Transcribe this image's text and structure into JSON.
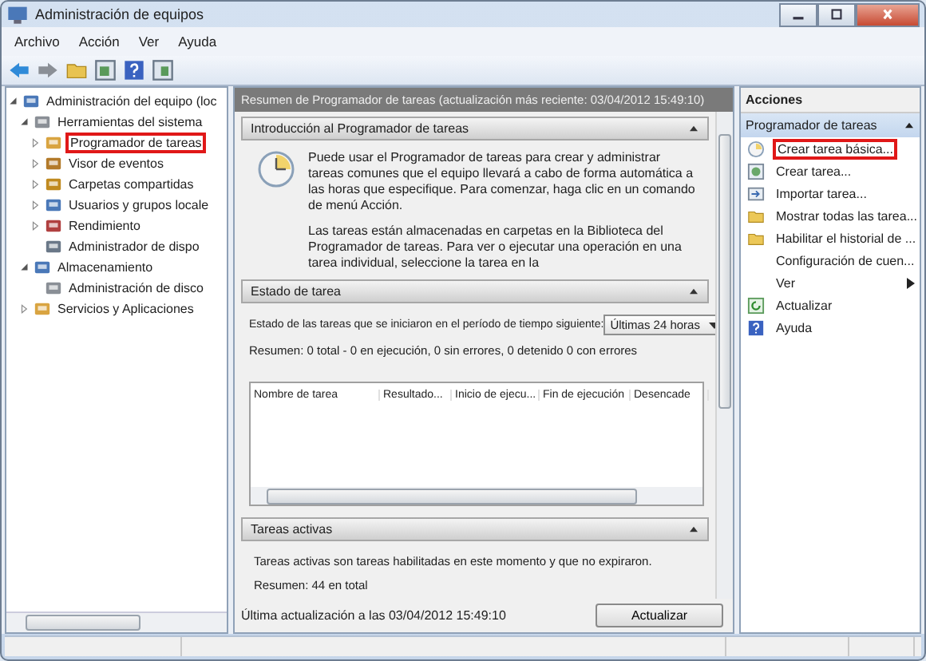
{
  "window": {
    "title": "Administración de equipos"
  },
  "menu": [
    "Archivo",
    "Acción",
    "Ver",
    "Ayuda"
  ],
  "tree": [
    {
      "label": "Administración del equipo (loc",
      "expanded": true,
      "highlighted": false,
      "children": [
        {
          "label": "Herramientas del sistema",
          "expanded": true,
          "highlighted": false,
          "children": [
            {
              "label": "Programador de tareas",
              "expanded": false,
              "highlighted": true
            },
            {
              "label": "Visor de eventos",
              "expanded": false,
              "highlighted": false
            },
            {
              "label": "Carpetas compartidas",
              "expanded": false,
              "highlighted": false
            },
            {
              "label": "Usuarios y grupos locale",
              "expanded": false,
              "highlighted": false
            },
            {
              "label": "Rendimiento",
              "expanded": false,
              "highlighted": false
            },
            {
              "label": "Administrador de dispo",
              "highlighted": false
            }
          ]
        },
        {
          "label": "Almacenamiento",
          "expanded": true,
          "highlighted": false,
          "children": [
            {
              "label": "Administración de disco",
              "highlighted": false
            }
          ]
        },
        {
          "label": "Servicios y Aplicaciones",
          "expanded": false,
          "highlighted": false
        }
      ]
    }
  ],
  "summary_header": "Resumen de Programador de tareas (actualización más reciente: 03/04/2012 15:49:10)",
  "intro": {
    "title": "Introducción al Programador de tareas",
    "expanded": true,
    "paragraphs": [
      "Puede usar el Programador de tareas para crear y administrar tareas comunes que el equipo llevará a cabo de forma automática a las horas que especifique. Para comenzar, haga clic en un comando de menú Acción.",
      "Las tareas están almacenadas en carpetas en la Biblioteca del Programador de tareas. Para ver o ejecutar una operación en una tarea individual, seleccione la tarea en la"
    ]
  },
  "task_status": {
    "title": "Estado de tarea",
    "expanded": true,
    "period_label": "Estado de las tareas que se iniciaron en el período de tiempo siguiente:",
    "period_value": "Últimas 24 horas",
    "summary": "Resumen: 0 total - 0 en ejecución, 0 sin errores, 0 detenido  0 con errores",
    "table": {
      "columns": [
        "Nombre de tarea",
        "Resultado...",
        "Inicio de ejecu...",
        "Fin de ejecución",
        "Desencade"
      ]
    }
  },
  "active_tasks": {
    "title": "Tareas activas",
    "expanded": true,
    "text": "Tareas activas son tareas habilitadas en este momento y que no expiraron.",
    "summary": "Resumen: 44 en total"
  },
  "last_update": "Última actualización a las 03/04/2012 15:49:10",
  "refresh_button": "Actualizar",
  "actions": {
    "title": "Acciones",
    "group": "Programador de tareas",
    "expanded": true,
    "items": [
      {
        "label": "Crear tarea básica...",
        "kind": "clock",
        "highlighted": true
      },
      {
        "label": "Crear tarea...",
        "kind": "task",
        "highlighted": false
      },
      {
        "label": "Importar tarea...",
        "kind": "import",
        "highlighted": false
      },
      {
        "label": "Mostrar todas las tarea...",
        "kind": "folder",
        "highlighted": false
      },
      {
        "label": "Habilitar el historial de ...",
        "kind": "folder",
        "highlighted": false
      },
      {
        "label": "Configuración de cuen...",
        "kind": "none",
        "highlighted": false
      },
      {
        "label": "Ver",
        "kind": "submenu",
        "highlighted": false
      },
      {
        "label": "Actualizar",
        "kind": "refresh",
        "highlighted": false
      },
      {
        "label": "Ayuda",
        "kind": "help",
        "highlighted": false
      }
    ]
  }
}
